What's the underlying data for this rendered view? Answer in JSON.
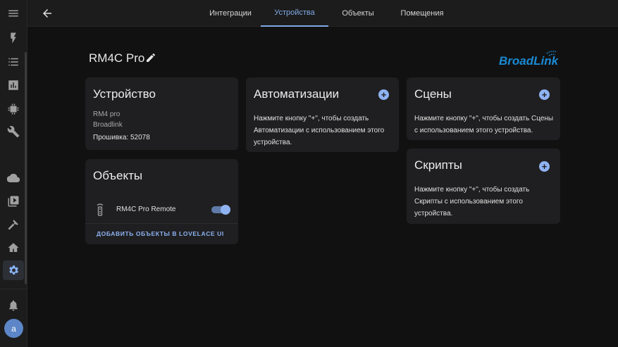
{
  "sidebar": {
    "items": [
      {
        "icon": "menu-icon"
      },
      {
        "icon": "lightning-icon"
      },
      {
        "icon": "list-icon"
      },
      {
        "icon": "chart-icon"
      },
      {
        "icon": "chip-icon"
      },
      {
        "icon": "wrench-icon"
      },
      {
        "icon": "cloud-icon"
      },
      {
        "icon": "media-icon"
      },
      {
        "icon": "hammer-icon"
      },
      {
        "icon": "home-gear-icon"
      },
      {
        "icon": "settings-icon",
        "active": true
      },
      {
        "icon": "bell-icon"
      }
    ],
    "avatar_letter": "a"
  },
  "tabs": [
    "Интеграции",
    "Устройства",
    "Объекты",
    "Помещения"
  ],
  "active_tab": "Устройства",
  "device": {
    "name": "RM4C Pro",
    "brand_logo": "BroadLink"
  },
  "device_card": {
    "title": "Устройство",
    "model": "RM4 pro",
    "manufacturer": "Broadlink",
    "firmware": "Прошивка: 52078"
  },
  "entities_card": {
    "title": "Объекты",
    "entity_name": "RM4C Pro Remote",
    "entity_on": true,
    "link": "ДОБАВИТЬ ОБЪЕКТЫ В LOVELACE UI"
  },
  "automations_card": {
    "title": "Автоматизации",
    "line1": "Нажмите кнопку \"+\", чтобы создать",
    "line2": "Автоматизации с использованием этого",
    "line3": "устройства."
  },
  "scenes_card": {
    "title": "Сцены",
    "line1": "Нажмите кнопку \"+\", чтобы создать Сцены",
    "line2": "с использованием этого устройства."
  },
  "scripts_card": {
    "title": "Скрипты",
    "line1": "Нажмите кнопку \"+\", чтобы создать",
    "line2": "Скрипты с использованием этого",
    "line3": "устройства."
  },
  "plus_symbol": "+",
  "colors": {
    "accent": "#8fb3f2",
    "background": "#111111",
    "card": "#1f1f21",
    "logo_blue": "#1a8ad4"
  }
}
